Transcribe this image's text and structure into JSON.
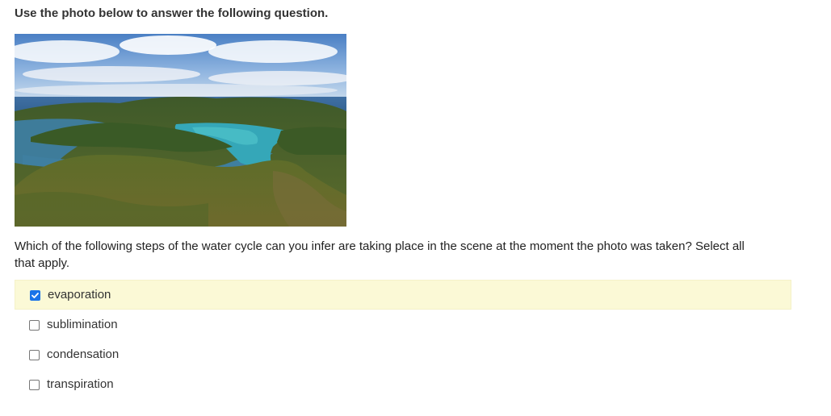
{
  "instruction": "Use the photo below to answer the following question.",
  "question": "Which of the following steps of the water cycle can you infer are taking place in the scene at the moment the photo was taken? Select all that apply.",
  "photo": {
    "icon": "aerial-lake-photo"
  },
  "options": [
    {
      "label": "evaporation",
      "checked": true
    },
    {
      "label": "sublimination",
      "checked": false
    },
    {
      "label": "condensation",
      "checked": false
    },
    {
      "label": "transpiration",
      "checked": false
    }
  ],
  "colors": {
    "selected_background": "#fbf9d6",
    "checkbox_checked": "#1a73e8",
    "text": "#333333"
  }
}
